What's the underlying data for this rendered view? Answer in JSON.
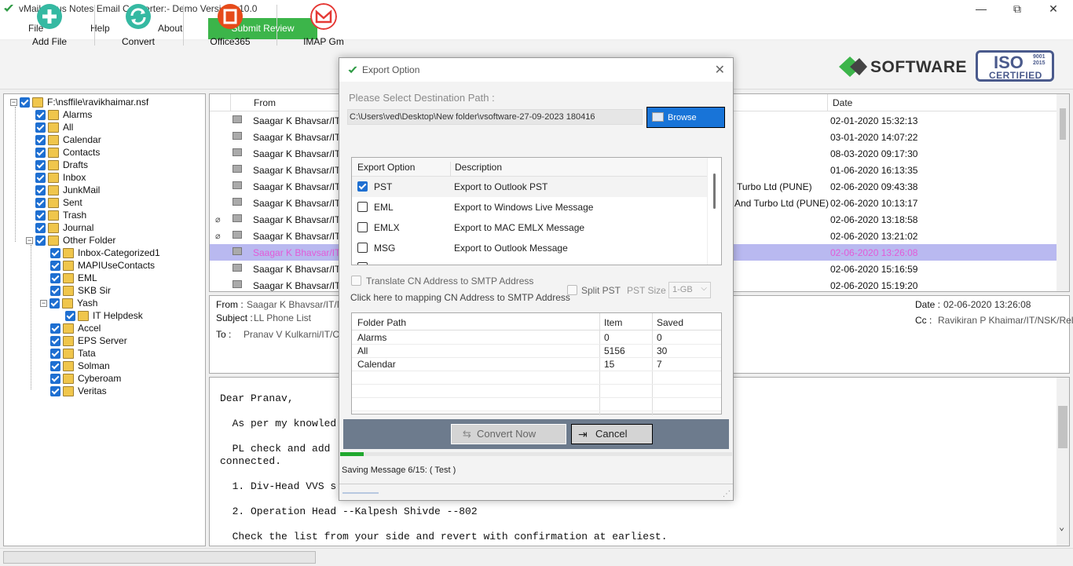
{
  "app": {
    "title": "vMail Lotus Notes Email Converter:- Demo Version v10.0",
    "window_controls": [
      "—",
      "⧉",
      "✕"
    ]
  },
  "menu": {
    "file": "File",
    "help": "Help",
    "about": "About",
    "submit_review": "Submit Review"
  },
  "toolbar": {
    "add_file": "Add File",
    "convert": "Convert",
    "office365": "Office365",
    "imap": "IMAP Gm"
  },
  "brand": {
    "name": "SOFTWARE",
    "iso": "ISO",
    "iso_years": "9001\n2015",
    "certified": "CERTIFIED"
  },
  "tree": {
    "root": "F:\\nsffile\\ravikhaimar.nsf",
    "items": [
      "Alarms",
      "All",
      "Calendar",
      "Contacts",
      "Drafts",
      "Inbox",
      "JunkMail",
      "Sent",
      "Trash",
      "Journal",
      "Other Folder"
    ],
    "other": [
      "Inbox-Categorized1",
      "MAPIUseContacts",
      "EML",
      "SKB Sir",
      "Yash"
    ],
    "yash_child": "IT Helpdesk",
    "rest": [
      "Accel",
      "EPS Server",
      "Tata",
      "Solman",
      "Cyberoam",
      "Veritas"
    ]
  },
  "list": {
    "col_from": "From",
    "col_date": "Date",
    "rows": [
      {
        "from": "Saagar K Bhavsar/IT/N",
        "extra": "",
        "date": "02-01-2020 15:32:13",
        "attach": false
      },
      {
        "from": "Saagar K Bhavsar/IT/N",
        "extra": "",
        "date": "03-01-2020 14:07:22",
        "attach": false
      },
      {
        "from": "Saagar K Bhavsar/IT/N",
        "extra": "",
        "date": "08-03-2020 09:17:30",
        "attach": false
      },
      {
        "from": "Saagar K Bhavsar/IT/N",
        "extra": "",
        "date": "01-06-2020 16:13:35",
        "attach": false
      },
      {
        "from": "Saagar K Bhavsar/IT/N",
        "extra": "Turbo Ltd (PUNE)",
        "date": "02-06-2020 09:43:38",
        "attach": false
      },
      {
        "from": "Saagar K Bhavsar/IT/N",
        "extra": "And Turbo Ltd (PUNE)",
        "date": "02-06-2020 10:13:17",
        "attach": false
      },
      {
        "from": "Saagar K Bhavsar/IT/N",
        "extra": "",
        "date": "02-06-2020 13:18:58",
        "attach": true
      },
      {
        "from": "Saagar K Bhavsar/IT/N",
        "extra": "",
        "date": "02-06-2020 13:21:02",
        "attach": true
      },
      {
        "from": "Saagar K Bhavsar/IT/N",
        "extra": "",
        "date": "02-06-2020 13:26:08",
        "attach": false
      },
      {
        "from": "Saagar K Bhavsar/IT/N",
        "extra": "",
        "date": "02-06-2020 15:16:59",
        "attach": false
      },
      {
        "from": "Saagar K Bhavsar/IT/N",
        "extra": "",
        "date": "02-06-2020 15:19:20",
        "attach": false
      }
    ],
    "selected_index": 8
  },
  "header": {
    "from_label": "From :",
    "from_value": "Saagar K Bhavsar/IT/NSK",
    "subject_label": "Subject :",
    "subject_value": "LL Phone List",
    "to_label": "To :",
    "to_value": "Pranav V Kulkarni/IT/CHE",
    "date_label": "Date :",
    "date_value": "02-06-2020 13:26:08",
    "cc_label": "Cc :",
    "cc_value": "Ravikiran P Khaimar/IT/NSK/Relia"
  },
  "body": {
    "lines": [
      "Dear Pranav,",
      "  As per my knowled",
      "  PL check and add",
      "connected.",
      "  1. Div-Head VVS s",
      "  2. Operation Head --Kalpesh Shivde --802",
      "  Check the list from your side and revert with confirmation at earliest."
    ]
  },
  "dialog": {
    "title": "Export Option",
    "dest_label": "Please Select Destination Path :",
    "path": "C:\\Users\\ved\\Desktop\\New folder\\vsoftware-27-09-2023 180416",
    "browse": "Browse",
    "opt_header": "Export Option",
    "desc_header": "Description",
    "options": [
      {
        "name": "PST",
        "desc": "Export to Outlook PST",
        "checked": true
      },
      {
        "name": "EML",
        "desc": "Export to Windows Live Message",
        "checked": false
      },
      {
        "name": "EMLX",
        "desc": "Export to MAC EMLX Message",
        "checked": false
      },
      {
        "name": "MSG",
        "desc": "Export to Outlook Message",
        "checked": false
      }
    ],
    "translate": "Translate CN Address to SMTP Address",
    "mapping": "Click here to mapping CN Address to SMTP Address",
    "split": "Split PST",
    "pst_size_label": "PST Size :",
    "pst_size": "1-GB",
    "folder_header": "Folder Path",
    "item_header": "Item",
    "saved_header": "Saved",
    "folders": [
      {
        "path": "Alarms",
        "item": "0",
        "saved": "0"
      },
      {
        "path": "All",
        "item": "5156",
        "saved": "30"
      },
      {
        "path": "Calendar",
        "item": "15",
        "saved": "7"
      }
    ],
    "convert_now": "Convert Now",
    "cancel": "Cancel",
    "progress": 0.06,
    "status": "Saving Message 6/15: ( Test )"
  },
  "colors": {
    "accent_green": "#3cb54a",
    "browse_blue": "#1874d8",
    "selected_row": "#b9b9f0"
  }
}
